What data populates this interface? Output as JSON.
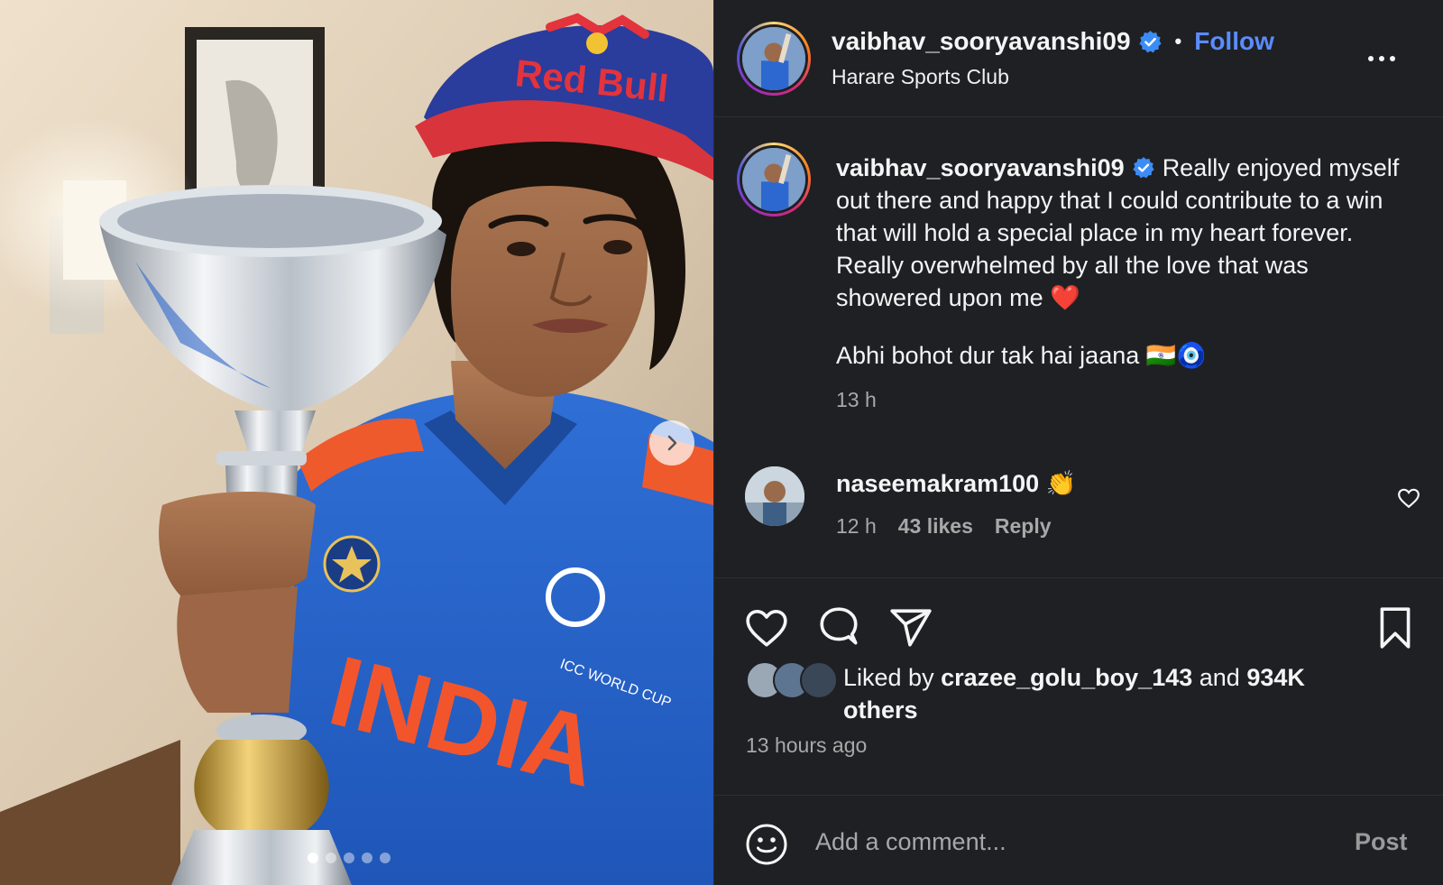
{
  "post": {
    "username": "vaibhav_sooryavanshi09",
    "location": "Harare Sports Club",
    "follow_label": "Follow",
    "separator": "•",
    "caption_username": "vaibhav_sooryavanshi09",
    "caption_text": "Really enjoyed myself out there and happy that I could contribute to a win that will hold a special place in my heart forever. Really overwhelmed by all the love that was showered upon me ❤️",
    "caption_line2": "Abhi bohot dur tak hai jaana 🇮🇳🧿",
    "caption_time": "13 h"
  },
  "comment": {
    "username": "naseemakram100",
    "text": "👏",
    "time": "12 h",
    "likes": "43 likes",
    "reply_label": "Reply"
  },
  "likes": {
    "prefix": "Liked by",
    "user": "crazee_golu_boy_143",
    "and": "and",
    "count": "934K others"
  },
  "post_time": "13 hours ago",
  "add_comment": {
    "placeholder": "Add a comment...",
    "post_label": "Post"
  },
  "carousel": {
    "total": 5,
    "active": 0
  },
  "photo": {
    "cap_brand": "Red Bull",
    "jersey_text": "INDIA"
  },
  "icons": {
    "verified": "verified-badge-icon",
    "more": "more-options-icon",
    "like": "heart-icon",
    "comment": "comment-bubble-icon",
    "share": "share-paper-plane-icon",
    "save": "bookmark-icon",
    "emoji": "emoji-smiley-icon",
    "next": "chevron-right-icon"
  },
  "colors": {
    "accent": "#5a8cff",
    "panel": "#1f2024",
    "muted": "#a8a8a8"
  }
}
